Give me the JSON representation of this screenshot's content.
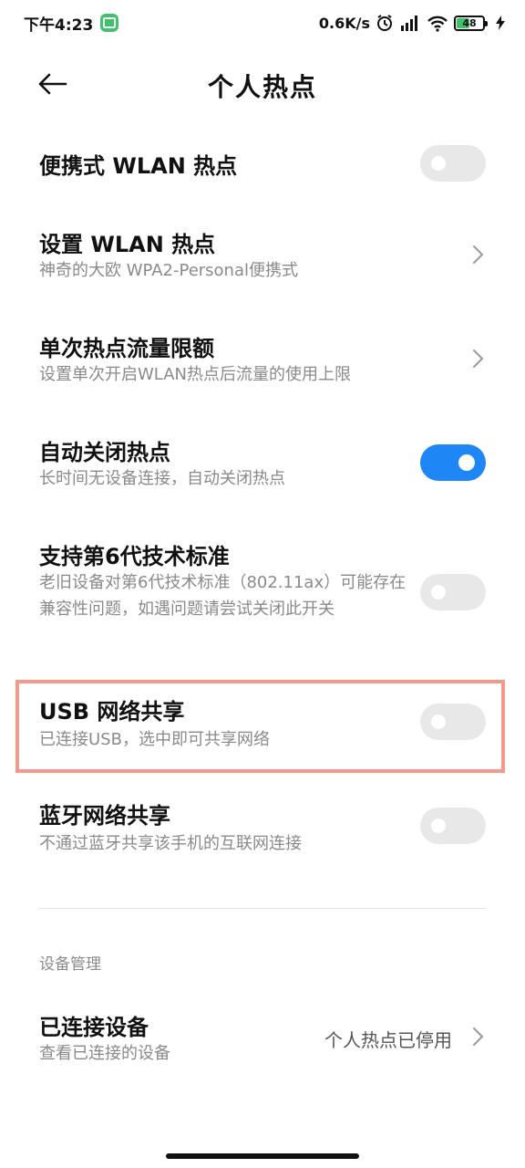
{
  "status_bar": {
    "time": "下午4:23",
    "net_speed": "0.6K/s",
    "battery_level": "48"
  },
  "header": {
    "title": "个人热点"
  },
  "settings": {
    "portable_wlan": {
      "title": "便携式 WLAN 热点",
      "enabled": false
    },
    "setup_wlan": {
      "title": "设置 WLAN 热点",
      "subtitle": "神奇的大欧 WPA2-Personal便携式"
    },
    "data_limit": {
      "title": "单次热点流量限额",
      "subtitle": "设置单次开启WLAN热点后流量的使用上限"
    },
    "auto_close": {
      "title": "自动关闭热点",
      "subtitle": "长时间无设备连接，自动关闭热点",
      "enabled": true
    },
    "wifi6": {
      "title": "支持第6代技术标准",
      "subtitle": "老旧设备对第6代技术标准（802.11ax）可能存在兼容性问题，如遇问题请尝试关闭此开关",
      "enabled": false
    },
    "usb_tether": {
      "title": "USB 网络共享",
      "subtitle": "已连接USB，选中即可共享网络",
      "enabled": false
    },
    "bt_tether": {
      "title": "蓝牙网络共享",
      "subtitle": "不通过蓝牙共享该手机的互联网连接",
      "enabled": false
    }
  },
  "device_section": {
    "label": "设备管理",
    "connected_devices": {
      "title": "已连接设备",
      "subtitle": "查看已连接的设备",
      "value": "个人热点已停用"
    }
  },
  "colors": {
    "toggle_on": "#1f86f5",
    "toggle_off": "#e8e8e8",
    "highlight_border": "#f59a8a",
    "subtitle_text": "#8a8a8a"
  }
}
